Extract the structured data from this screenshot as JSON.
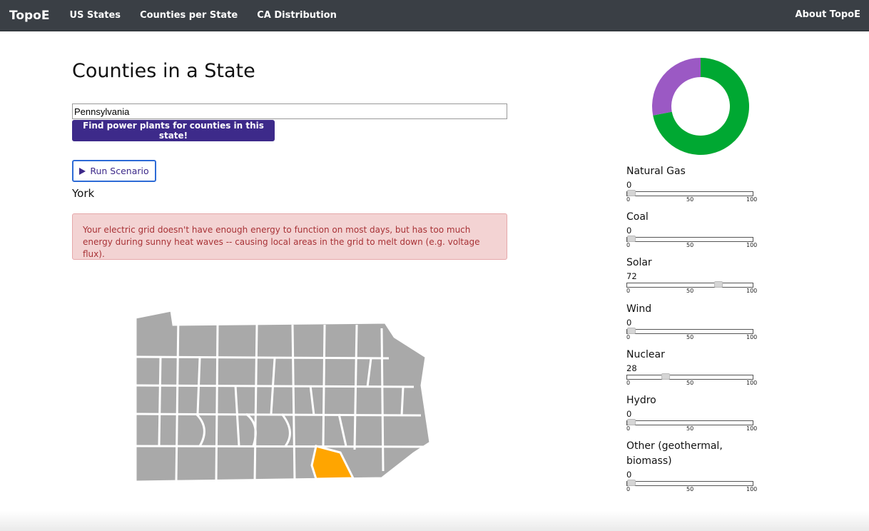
{
  "navbar": {
    "brand": "TopoE",
    "links": [
      "US States",
      "Counties per State",
      "CA Distribution"
    ],
    "right_link": "About TopoE"
  },
  "main": {
    "title": "Counties in a State",
    "state_input_value": "Pennsylvania",
    "find_button_label": "Find power plants for counties in this state!",
    "run_button_label": "Run Scenario",
    "selected_county": "York",
    "alert_text": "Your electric grid doesn't have enough energy to function on most days, but has too much energy during sunny heat waves -- causing local areas in the grid to melt down (e.g. voltage flux)."
  },
  "colors": {
    "nav_bg": "#3a3f45",
    "primary_button": "#3d2a8a",
    "county_default": "#a9a9a9",
    "county_selected": "#ffa500",
    "alert_bg": "#f3d3d3",
    "alert_text": "#a83236",
    "donut_solar": "#00a832",
    "donut_nuclear": "#9b59c4"
  },
  "donut": {
    "segments": [
      {
        "name": "Solar",
        "value": 72,
        "color": "#00a832"
      },
      {
        "name": "Nuclear",
        "value": 28,
        "color": "#9b59c4"
      }
    ]
  },
  "sliders": {
    "ticks": [
      "0",
      "50",
      "100"
    ],
    "items": [
      {
        "label": "Natural Gas",
        "value": 0
      },
      {
        "label": "Coal",
        "value": 0
      },
      {
        "label": "Solar",
        "value": 72
      },
      {
        "label": "Wind",
        "value": 0
      },
      {
        "label": "Nuclear",
        "value": 28
      },
      {
        "label": "Hydro",
        "value": 0
      },
      {
        "label": "Other (geothermal, biomass)",
        "value": 0
      }
    ]
  }
}
